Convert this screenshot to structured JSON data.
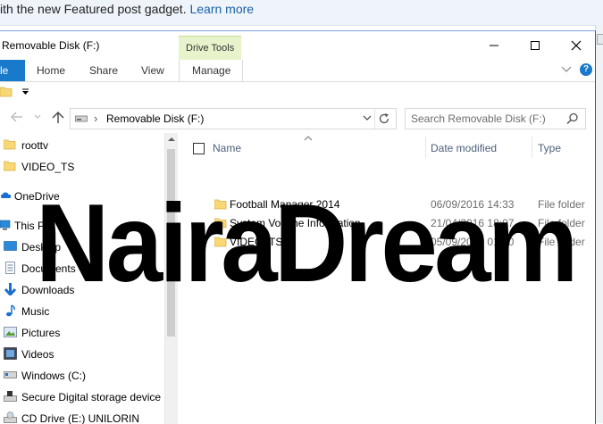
{
  "banner": {
    "text": "ith the new Featured post gadget. ",
    "link": "Learn more"
  },
  "window": {
    "title": "Removable Disk (F:)",
    "context_group": "Drive Tools"
  },
  "ribbon": {
    "tabs": {
      "file": "le",
      "home": "Home",
      "share": "Share",
      "view": "View",
      "manage": "Manage"
    }
  },
  "address": {
    "path": "Removable Disk (F:)",
    "search_placeholder": "Search Removable Disk (F:)"
  },
  "nav": {
    "items": [
      {
        "label": "roottv",
        "icon": "folder-icon"
      },
      {
        "label": "VIDEO_TS",
        "icon": "folder-icon"
      },
      {
        "label": "OneDrive",
        "icon": "onedrive-icon"
      },
      {
        "label": "This PC",
        "icon": "this-pc-icon"
      },
      {
        "label": "Desktop",
        "icon": "desktop-icon"
      },
      {
        "label": "Documents",
        "icon": "documents-icon"
      },
      {
        "label": "Downloads",
        "icon": "downloads-icon"
      },
      {
        "label": "Music",
        "icon": "music-icon"
      },
      {
        "label": "Pictures",
        "icon": "pictures-icon"
      },
      {
        "label": "Videos",
        "icon": "videos-icon"
      },
      {
        "label": "Windows (C:)",
        "icon": "windows-drive-icon"
      },
      {
        "label": "Secure Digital storage device (",
        "icon": "sd-drive-icon"
      },
      {
        "label": "CD Drive (E:) UNILORIN",
        "icon": "cd-drive-icon"
      }
    ]
  },
  "files": {
    "columns": {
      "name": "Name",
      "date": "Date modified",
      "type": "Type"
    },
    "rows": [
      {
        "name": "Football Manager 2014",
        "date": "06/09/2016 14:33",
        "type": "File folder"
      },
      {
        "name": "System Volume Information",
        "date": "21/04/2016 18:07",
        "type": "File folder"
      },
      {
        "name": "VIDEO_TS",
        "date": "05/09/2008 01:10",
        "type": "File folder"
      }
    ]
  },
  "watermark": "NairaDream",
  "colors": {
    "accent": "#1979ca",
    "context_tab": "#e7f4cb",
    "folder": "#f8d775"
  }
}
